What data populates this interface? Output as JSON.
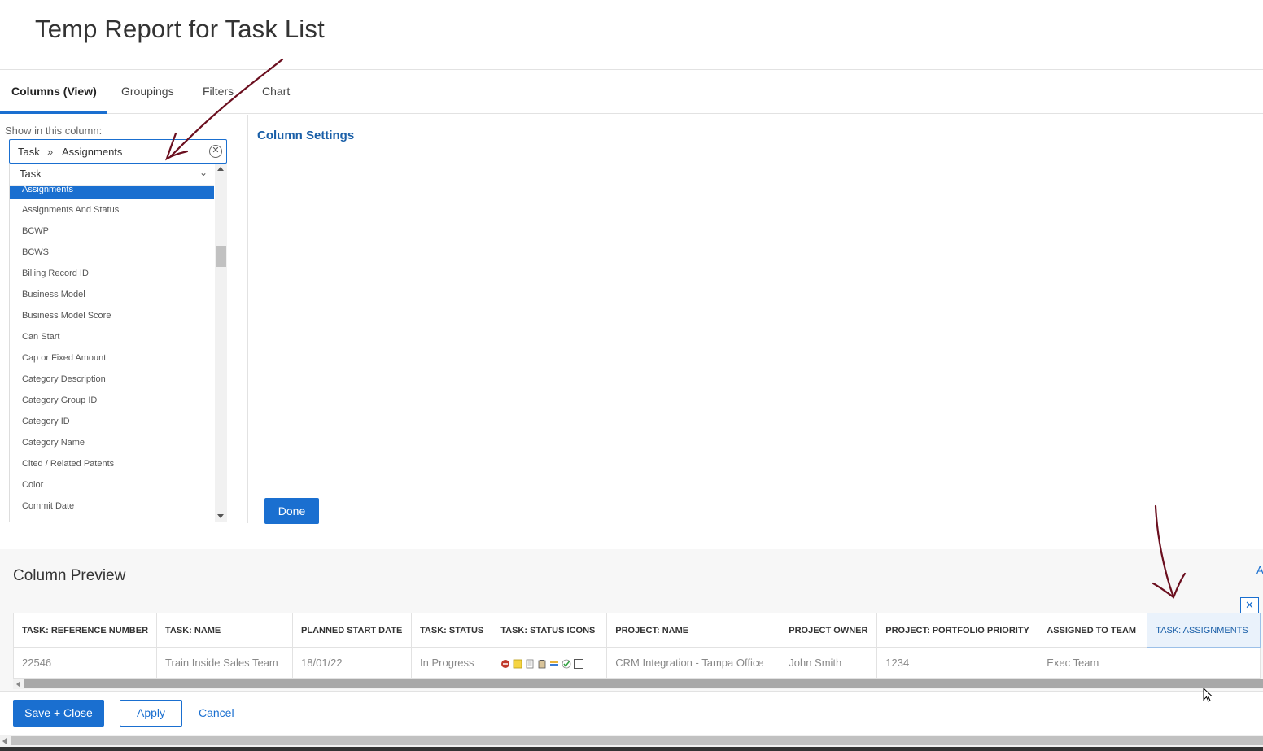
{
  "page": {
    "title": "Temp Report for Task List"
  },
  "tabs": [
    {
      "label": "Columns (View)",
      "active": true
    },
    {
      "label": "Groupings"
    },
    {
      "label": "Filters"
    },
    {
      "label": "Chart"
    }
  ],
  "left_panel": {
    "show_label": "Show in this column:",
    "field": {
      "object": "Task",
      "separator": "»",
      "field": "Assignments"
    },
    "group": "Task",
    "items": [
      "Assignments",
      "Assignments And Status",
      "BCWP",
      "BCWS",
      "Billing Record ID",
      "Business Model",
      "Business Model Score",
      "Can Start",
      "Cap or Fixed Amount",
      "Category Description",
      "Category Group ID",
      "Category ID",
      "Category Name",
      "Cited / Related Patents",
      "Color",
      "Commit Date"
    ],
    "selected_index": 0
  },
  "settings": {
    "title": "Column Settings",
    "done_label": "Done"
  },
  "preview": {
    "title": "Column Preview",
    "right_link": "A",
    "close_label": "✕",
    "headers": [
      "TASK: REFERENCE NUMBER",
      "TASK: NAME",
      "PLANNED START DATE",
      "TASK: STATUS",
      "TASK: STATUS ICONS",
      "PROJECT: NAME",
      "PROJECT OWNER",
      "PROJECT: PORTFOLIO PRIORITY",
      "ASSIGNED TO TEAM",
      "TASK: ASSIGNMENTS"
    ],
    "row": {
      "ref": "22546",
      "name": "Train Inside Sales Team",
      "start": "18/01/22",
      "status": "In Progress",
      "project": "CRM Integration - Tampa Office",
      "owner": "John Smith",
      "priority": "1234",
      "team": "Exec Team",
      "assignments": ""
    }
  },
  "footer": {
    "save_close": "Save + Close",
    "apply": "Apply",
    "cancel": "Cancel"
  },
  "colors": {
    "accent": "#1a6fd0",
    "link": "#1a5fa8",
    "annotation": "#6b0f1f"
  }
}
